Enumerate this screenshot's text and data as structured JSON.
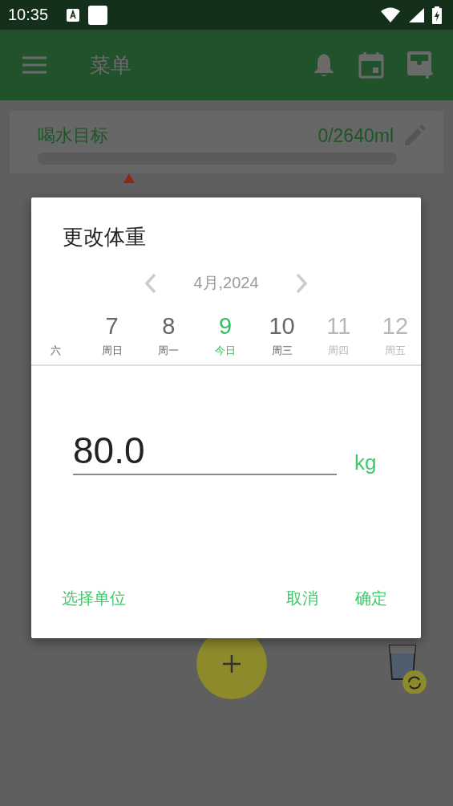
{
  "status_bar": {
    "time": "10:35"
  },
  "app_bar": {
    "title": "菜单"
  },
  "water_goal": {
    "label": "喝水目标",
    "amount": "0/2640ml",
    "level": 0
  },
  "dialog": {
    "title": "更改体重",
    "month": "4月,2024",
    "days": [
      {
        "kind": "past",
        "weekday": "六"
      },
      {
        "kind": "past",
        "day": "7",
        "weekday": "周日"
      },
      {
        "kind": "past",
        "day": "8",
        "weekday": "周一"
      },
      {
        "kind": "today",
        "day": "9",
        "weekday": "今日"
      },
      {
        "kind": "past",
        "day": "10",
        "weekday": "周三"
      },
      {
        "kind": "future",
        "day": "11",
        "weekday": "周四"
      },
      {
        "kind": "future",
        "day": "12",
        "weekday": "周五"
      }
    ],
    "weight": "80.0",
    "unit": "kg",
    "buttons": {
      "unit": "选择单位",
      "cancel": "取消",
      "ok": "确定"
    }
  }
}
